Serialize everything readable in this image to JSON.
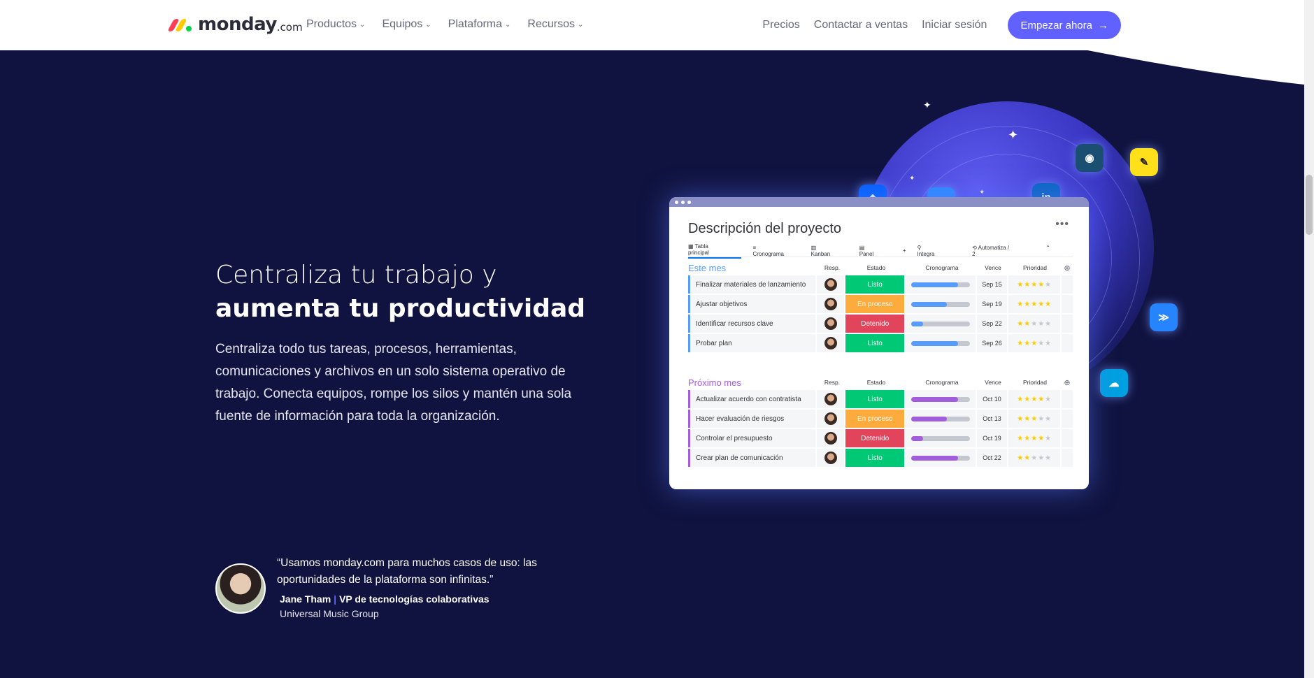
{
  "nav": {
    "logo_word": "monday",
    "logo_suffix": ".com",
    "menu": [
      "Productos",
      "Equipos",
      "Plataforma",
      "Recursos"
    ],
    "pricing": "Precios",
    "contact_sales": "Contactar a ventas",
    "login": "Iniciar sesión",
    "cta": "Empezar ahora"
  },
  "hero": {
    "title_light": "Centraliza tu trabajo y",
    "title_bold": "aumenta tu productividad",
    "body": "Centraliza todo tus tareas, procesos, herramientas, comunicaciones y archivos en un solo sistema operativo de trabajo. Conecta equipos, rompe los silos y mantén una sola fuente de información para toda la organización."
  },
  "testimonial": {
    "quote": "“Usamos monday.com para muchos casos de uso: las oportunidades de la plataforma son infinitas.”",
    "name": "Jane Tham",
    "role": "VP de tecnologías colaborativas",
    "company": "Universal Music Group"
  },
  "board": {
    "title": "Descripción del proyecto",
    "views": [
      "Tabla principal",
      "Cronograma",
      "Kanban",
      "Panel",
      "+"
    ],
    "integrate": "Integra",
    "automate": "Automatiza / 2",
    "columns": [
      "Resp.",
      "Estado",
      "Cronograma",
      "Vence",
      "Prioridad"
    ],
    "groups": [
      {
        "name": "Este mes",
        "color": "#579bfc",
        "tasks": [
          {
            "name": "Finalizar materiales de lanzamiento",
            "status": "Listo",
            "status_color": "#00c875",
            "progress": 0.8,
            "due": "Sep 15",
            "priority": 4
          },
          {
            "name": "Ajustar objetivos",
            "status": "En proceso",
            "status_color": "#fdab3d",
            "progress": 0.6,
            "due": "Sep 19",
            "priority": 5
          },
          {
            "name": "Identificar recursos clave",
            "status": "Detenido",
            "status_color": "#e2445c",
            "progress": 0.2,
            "due": "Sep 22",
            "priority": 2
          },
          {
            "name": "Probar plan",
            "status": "Listo",
            "status_color": "#00c875",
            "progress": 0.8,
            "due": "Sep 26",
            "priority": 3
          }
        ]
      },
      {
        "name": "Próximo mes",
        "color": "#a25ddc",
        "tasks": [
          {
            "name": "Actualizar acuerdo con contratista",
            "status": "Listo",
            "status_color": "#00c875",
            "progress": 0.8,
            "due": "Oct 10",
            "priority": 4
          },
          {
            "name": "Hacer evaluación de riesgos",
            "status": "En proceso",
            "status_color": "#fdab3d",
            "progress": 0.6,
            "due": "Oct 13",
            "priority": 3
          },
          {
            "name": "Controlar el presupuesto",
            "status": "Detenido",
            "status_color": "#e2445c",
            "progress": 0.2,
            "due": "Oct 19",
            "priority": 4
          },
          {
            "name": "Crear plan de comunicación",
            "status": "Listo",
            "status_color": "#00c875",
            "progress": 0.8,
            "due": "Oct 22",
            "priority": 2
          }
        ]
      }
    ]
  },
  "integrations": [
    "dropbox-icon",
    "zoom-icon",
    "linkedin-icon",
    "webex-icon",
    "mailchimp-icon",
    "jira-icon",
    "salesforce-icon"
  ],
  "colors": {
    "brand": "#6161ff",
    "background": "#10133f"
  }
}
